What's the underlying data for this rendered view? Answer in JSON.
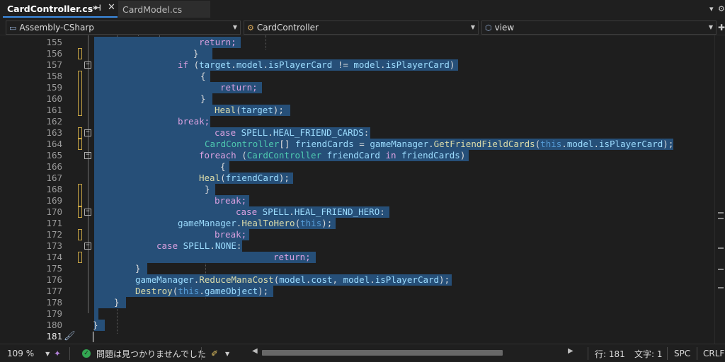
{
  "tabs": [
    {
      "label": "CardController.cs*",
      "active": true
    },
    {
      "label": "CardModel.cs",
      "active": false
    }
  ],
  "tab_pin_icon": "pin-icon",
  "tab_close_icon": "close-icon",
  "navbar": {
    "project": "Assembly-CSharp",
    "class": "CardController",
    "member": "view"
  },
  "editor": {
    "lines": [
      {
        "num": "155",
        "text": "return;"
      },
      {
        "num": "156",
        "text": "}"
      },
      {
        "num": "157",
        "text": "if (target.model.isPlayerCard != model.isPlayerCard)"
      },
      {
        "num": "158",
        "text": "{"
      },
      {
        "num": "159",
        "text": "return;"
      },
      {
        "num": "160",
        "text": "}"
      },
      {
        "num": "161",
        "text": "Heal(target);"
      },
      {
        "num": "162",
        "text": "break;"
      },
      {
        "num": "163",
        "text": "case SPELL.HEAL_FRIEND_CARDS:"
      },
      {
        "num": "164",
        "text": "CardController[] friendCards = gameManager.GetFriendFieldCards(this.model.isPlayerCard);"
      },
      {
        "num": "165",
        "text": "foreach (CardController friendCard in friendCards)"
      },
      {
        "num": "166",
        "text": "{"
      },
      {
        "num": "167",
        "text": "Heal(friendCard);"
      },
      {
        "num": "168",
        "text": "}"
      },
      {
        "num": "169",
        "text": "break;"
      },
      {
        "num": "170",
        "text": "case SPELL.HEAL_FRIEND_HERO:"
      },
      {
        "num": "171",
        "text": "gameManager.HealToHero(this);"
      },
      {
        "num": "172",
        "text": "break;"
      },
      {
        "num": "173",
        "text": "case SPELL.NONE:"
      },
      {
        "num": "174",
        "text": "return;"
      },
      {
        "num": "175",
        "text": "}"
      },
      {
        "num": "176",
        "text": "gameManager.ReduceManaCost(model.cost, model.isPlayerCard);"
      },
      {
        "num": "177",
        "text": "Destroy(this.gameObject);"
      },
      {
        "num": "178",
        "text": "}"
      },
      {
        "num": "179",
        "text": ""
      },
      {
        "num": "180",
        "text": "}"
      },
      {
        "num": "181",
        "text": ""
      }
    ]
  },
  "status": {
    "zoom": "109 %",
    "issues": "問題は見つかりませんでした",
    "line": "行: 181",
    "col": "文字: 1",
    "whitespace": "SPC",
    "eol": "CRLF"
  },
  "colors": {
    "selection": "#264f78",
    "keyword": "#569cd6",
    "control": "#d8a0df",
    "type": "#4ec9b0",
    "method": "#dcdcaa",
    "accent": "#3c8ce3"
  }
}
